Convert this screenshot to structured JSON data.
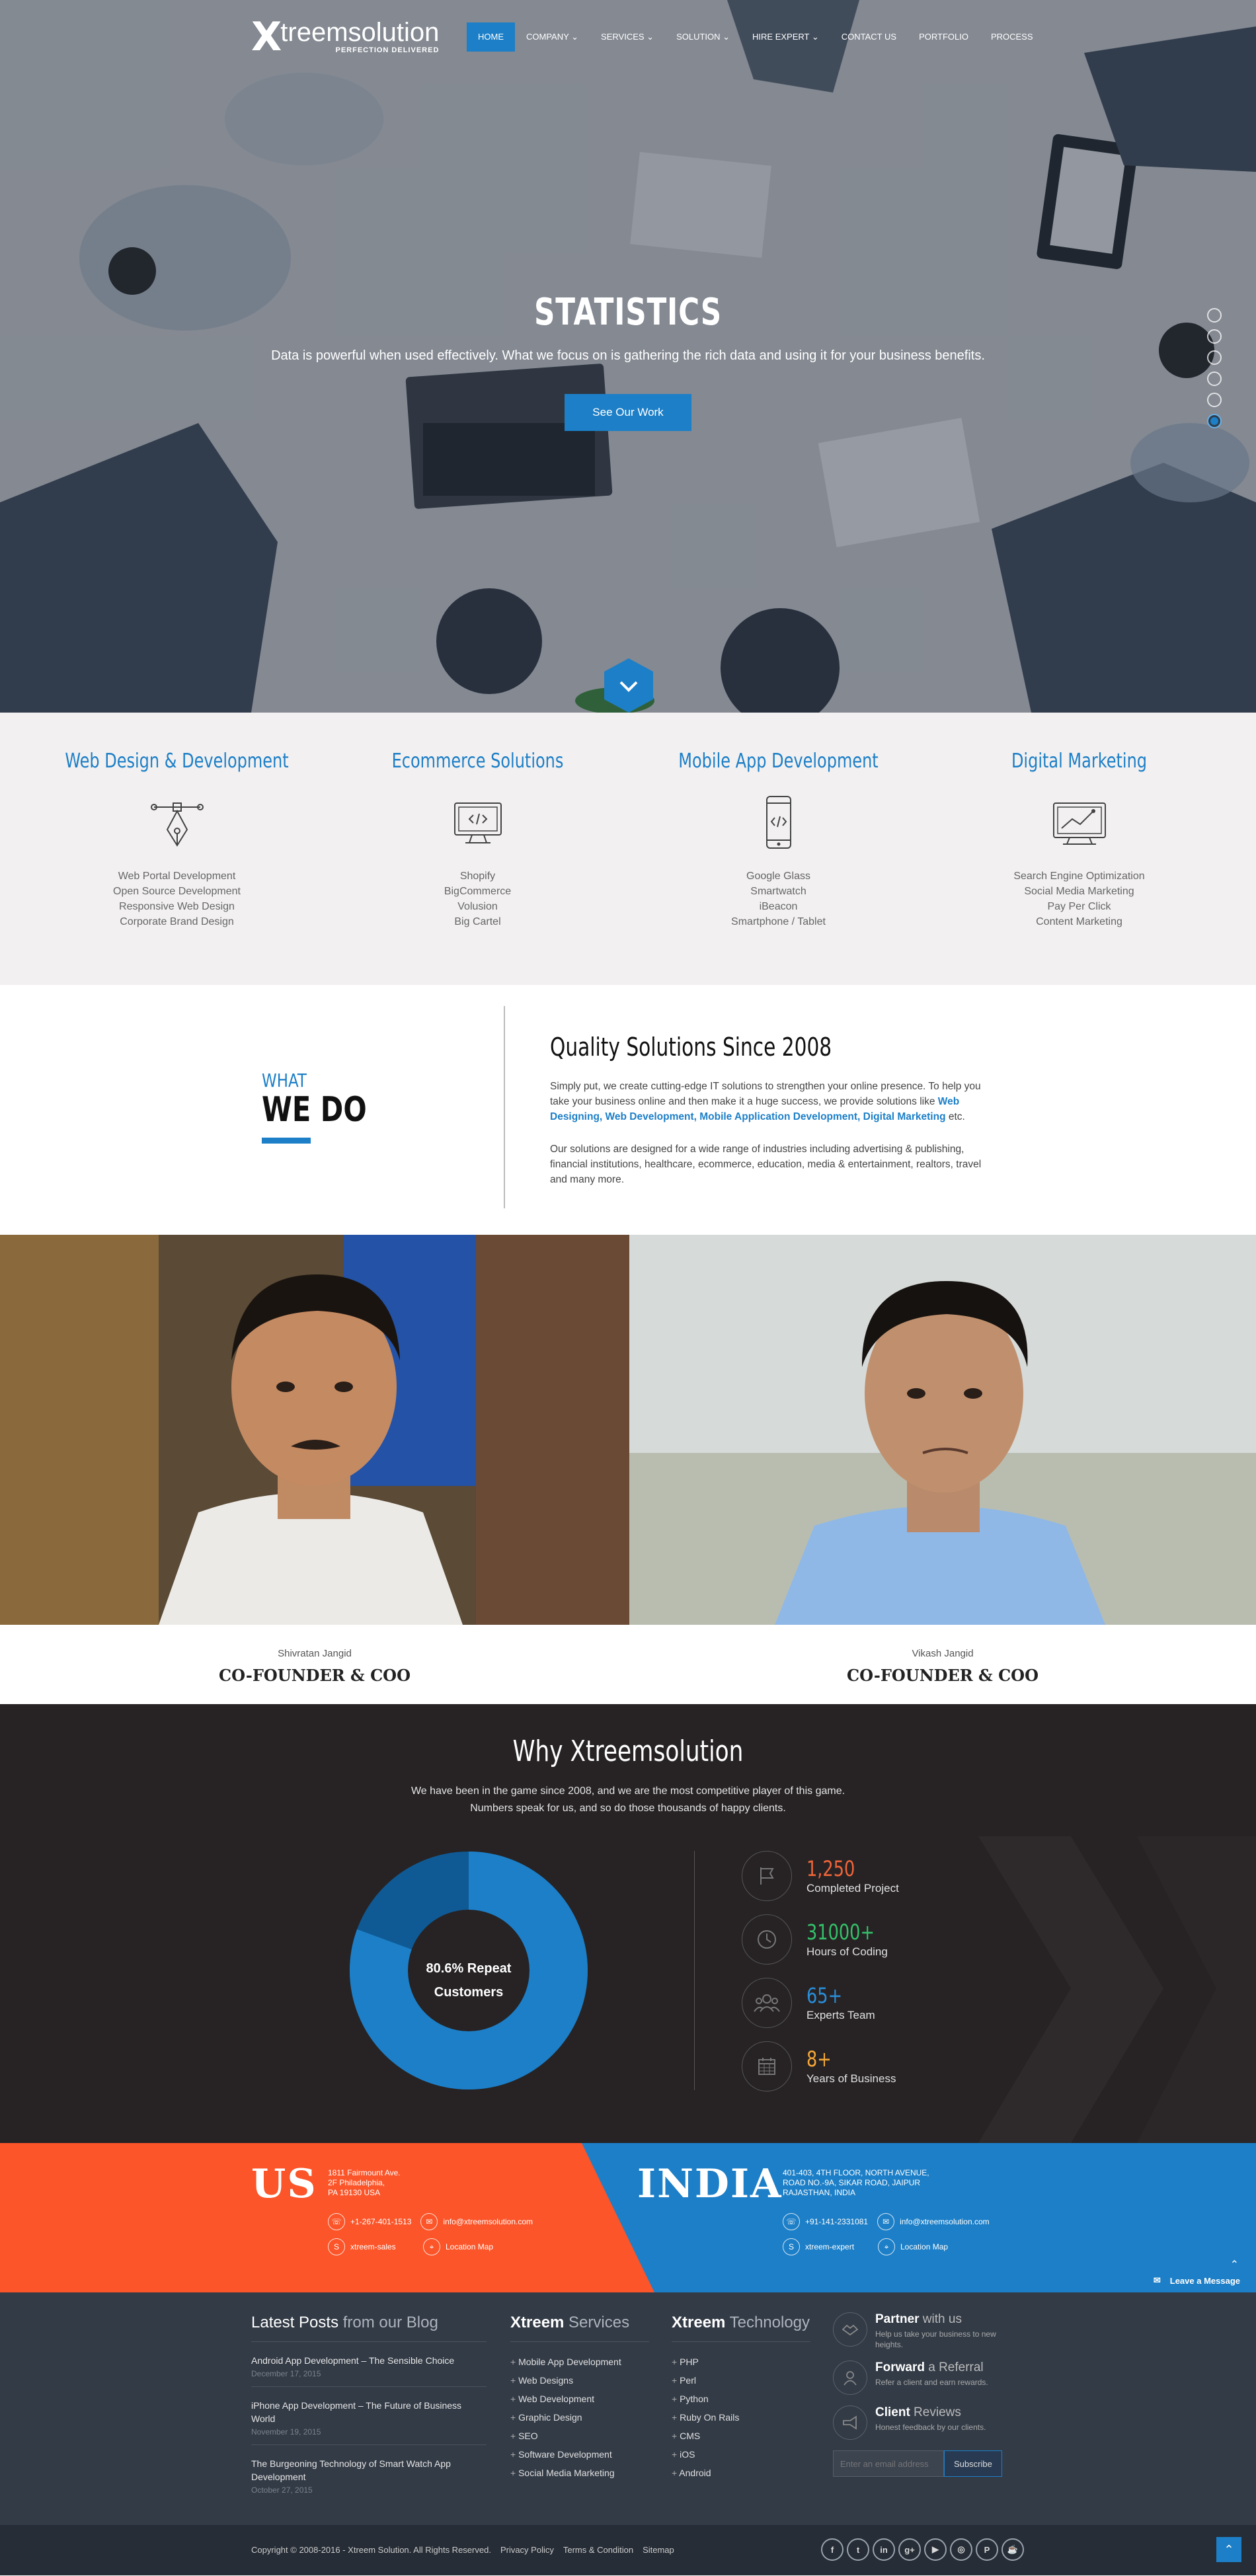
{
  "brand": {
    "logo_mark": "X",
    "logo_name": "treemsolution",
    "tagline": "PERFECTION DELIVERED"
  },
  "nav": {
    "items": [
      {
        "label": "HOME",
        "active": true
      },
      {
        "label": "COMPANY ⌄"
      },
      {
        "label": "SERVICES ⌄"
      },
      {
        "label": "SOLUTION ⌄"
      },
      {
        "label": "HIRE EXPERT ⌄"
      },
      {
        "label": "CONTACT US"
      },
      {
        "label": "PORTFOLIO"
      },
      {
        "label": "PROCESS"
      }
    ]
  },
  "hero": {
    "title": "STATISTICS",
    "subtitle": "Data is powerful when used effectively. What we focus on is gathering the rich data and using it for your business benefits.",
    "button": "See Our Work",
    "slides": 6,
    "active_slide": 6
  },
  "services": [
    {
      "title": "Web Design & Development",
      "icon": "pen-nib-icon",
      "items": [
        "Web Portal Development",
        "Open Source Development",
        "Responsive Web Design",
        "Corporate Brand Design"
      ]
    },
    {
      "title": "Ecommerce Solutions",
      "icon": "monitor-code-icon",
      "items": [
        "Shopify",
        "BigCommerce",
        "Volusion",
        "Big Cartel"
      ]
    },
    {
      "title": "Mobile App Development",
      "icon": "mobile-code-icon",
      "items": [
        "Google Glass",
        "Smartwatch",
        "iBeacon",
        "Smartphone / Tablet"
      ]
    },
    {
      "title": "Digital Marketing",
      "icon": "chart-monitor-icon",
      "items": [
        "Search Engine Optimization",
        "Social Media Marketing",
        "Pay Per Click",
        "Content Marketing"
      ]
    }
  ],
  "what_we_do": {
    "label_small": "WHAT",
    "label_big": "WE DO",
    "title": "Quality Solutions Since 2008",
    "p1_start": "Simply put, we create cutting-edge IT solutions to strengthen your online presence. To help you take your business online and then make it a huge success, we provide solutions like ",
    "p1_links": "Web Designing, Web Development, Mobile Application Development, Digital Marketing",
    "p1_end": " etc.",
    "p2": "Our solutions are designed for a wide range of industries including advertising & publishing, financial institutions, healthcare, ecommerce, education, media & entertainment, realtors, travel and many more."
  },
  "founders": [
    {
      "name": "Shivratan Jangid",
      "role": "CO-FOUNDER & COO"
    },
    {
      "name": "Vikash Jangid",
      "role": "CO-FOUNDER & COO"
    }
  ],
  "why": {
    "title": "Why Xtreemsolution",
    "sub1": "We have been in the game since 2008, and we are the most competitive player of this game.",
    "sub2": "Numbers speak for us, and so do those thousands of happy clients.",
    "donut_label1": "80.6% Repeat",
    "donut_label2": "Customers",
    "donut_percent": 80.6,
    "stats": [
      {
        "value": "1,250",
        "label": "Completed Project",
        "color": "#f0653a",
        "icon": "flag-icon"
      },
      {
        "value": "31000+",
        "label": "Hours of Coding",
        "color": "#34c06a",
        "icon": "clock-icon"
      },
      {
        "value": "65+",
        "label": "Experts Team",
        "color": "#2a8ed9",
        "icon": "team-icon"
      },
      {
        "value": "8+",
        "label": "Years of Business",
        "color": "#f4a637",
        "icon": "calendar-icon"
      }
    ]
  },
  "contact": {
    "us": {
      "label": "US",
      "addr1": "1811 Fairmount Ave.",
      "addr2": "2F Philadelphia,",
      "addr3": "PA 19130 USA",
      "phone": "+1-267-401-1513",
      "email": "info@xtreemsolution.com",
      "skype": "xtreem-sales",
      "map": "Location Map"
    },
    "india": {
      "label": "INDIA",
      "addr1": "401-403, 4TH FLOOR, NORTH AVENUE,",
      "addr2": "ROAD NO.-9A, SIKAR ROAD, JAIPUR",
      "addr3": "RAJASTHAN, INDIA",
      "phone": "+91-141-2331081",
      "email": "info@xtreemsolution.com",
      "skype": "xtreem-expert",
      "map": "Location Map"
    },
    "leave_message": "Leave a Message"
  },
  "footer": {
    "blog_head_a": "Latest Posts",
    "blog_head_b": " from our Blog",
    "posts": [
      {
        "title": "Android App Development – The Sensible Choice",
        "date": "December 17, 2015"
      },
      {
        "title": "iPhone App Development – The Future of Business World",
        "date": "November 19, 2015"
      },
      {
        "title": "The Burgeoning Technology of Smart Watch App Development",
        "date": "October 27, 2015"
      }
    ],
    "services_head_a": "Xtreem",
    "services_head_b": " Services",
    "services": [
      "Mobile App Development",
      "Web Designs",
      "Web Development",
      "Graphic Design",
      "SEO",
      "Software Development",
      "Social Media Marketing"
    ],
    "tech_head_a": "Xtreem",
    "tech_head_b": " Technology",
    "tech": [
      "PHP",
      "Perl",
      "Python",
      "Ruby On Rails",
      "CMS",
      "iOS",
      "Android"
    ],
    "partners": [
      {
        "title_a": "Partner",
        "title_b": " with us",
        "desc": "Help us take your business to new heights.",
        "icon": "handshake-icon"
      },
      {
        "title_a": "Forward",
        "title_b": " a Referral",
        "desc": "Refer a client and earn rewards.",
        "icon": "referral-icon"
      },
      {
        "title_a": "Client",
        "title_b": " Reviews",
        "desc": "Honest feedback by our clients.",
        "icon": "megaphone-icon"
      }
    ],
    "subscribe_placeholder": "Enter an email address",
    "subscribe_button": "Subscribe"
  },
  "bottom": {
    "copyright": "Copyright © 2008-2016 - Xtreem Solution. All Rights Reserved.",
    "links": [
      "Privacy Policy",
      "Terms & Condition",
      "Sitemap"
    ],
    "socials": [
      {
        "glyph": "f",
        "icon": "facebook-icon"
      },
      {
        "glyph": "t",
        "icon": "twitter-icon"
      },
      {
        "glyph": "in",
        "icon": "linkedin-icon"
      },
      {
        "glyph": "g+",
        "icon": "google-plus-icon"
      },
      {
        "glyph": "▶",
        "icon": "youtube-icon"
      },
      {
        "glyph": "◎",
        "icon": "instagram-icon"
      },
      {
        "glyph": "P",
        "icon": "pinterest-icon"
      },
      {
        "glyph": "☕",
        "icon": "blog-icon"
      }
    ]
  },
  "colors": {
    "accent": "#1d7fc7",
    "orange": "#fb5529",
    "dark": "#272324",
    "footer": "#333b46"
  }
}
